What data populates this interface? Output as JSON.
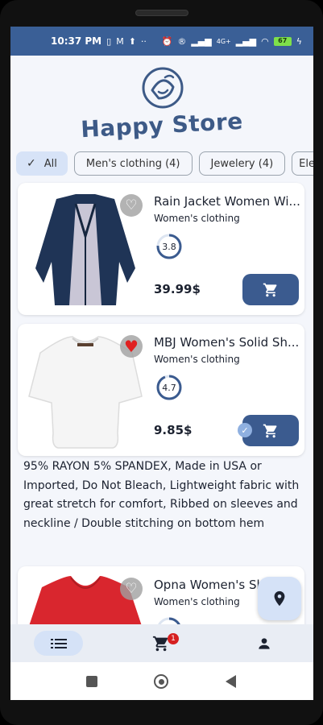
{
  "status_bar": {
    "time": "10:37 PM",
    "left_icons": [
      "sim-icon",
      "gmail-icon",
      "upload-icon",
      "more-dots-icon"
    ],
    "network": "4G+",
    "battery": "67"
  },
  "header": {
    "store_name": "Happy Store",
    "logo_icon": "happy-bag-logo-icon"
  },
  "filters": [
    {
      "label": "All",
      "selected": true
    },
    {
      "label": "Men's clothing (4)",
      "selected": false
    },
    {
      "label": "Jewelery (4)",
      "selected": false
    },
    {
      "label": "Ele",
      "selected": false
    }
  ],
  "products": [
    {
      "name": "Rain Jacket Women Wi...",
      "category": "Women's clothing",
      "rating": "3.8",
      "price": "39.99$",
      "favorite": false,
      "in_cart": false
    },
    {
      "name": "MBJ Women's Solid Sh...",
      "category": "Women's clothing",
      "rating": "4.7",
      "price": "9.85$",
      "favorite": true,
      "in_cart": true,
      "description": "95% RAYON 5% SPANDEX, Made in USA or Imported, Do Not Bleach, Lightweight fabric with great stretch for comfort, Ribbed on sleeves and neckline / Double stitching on bottom hem"
    },
    {
      "name": "Opna Women's Sh...",
      "category": "Women's clothing",
      "favorite": false
    }
  ],
  "bottom_nav": {
    "items": [
      "list-icon",
      "cart-icon",
      "person-icon"
    ],
    "cart_badge": "1",
    "active": "list-icon"
  },
  "colors": {
    "primary": "#3b5b8f",
    "status_bar": "#3a5f96",
    "chip_selected": "#d7e3f7",
    "favorite_red": "#e02020"
  }
}
